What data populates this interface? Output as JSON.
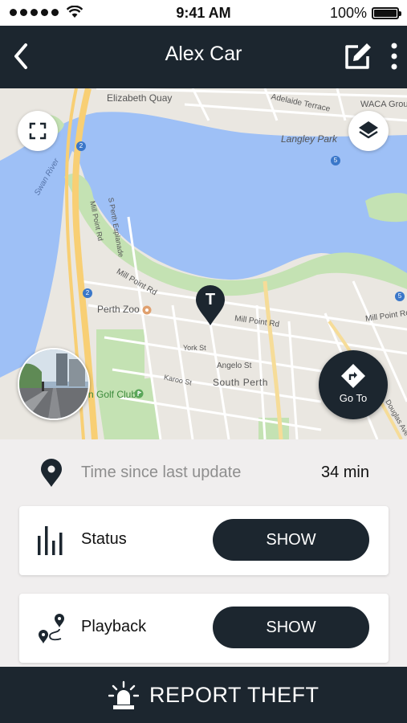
{
  "status_bar": {
    "time": "9:41 AM",
    "battery": "100%",
    "battery_level": 1.0
  },
  "nav": {
    "title": "Alex Car"
  },
  "map": {
    "labels": {
      "elizabeth_quay": "Elizabeth Quay",
      "adelaide_terrace": "Adelaide Terrace",
      "waca_ground": "WACA Ground",
      "langley_park": "Langley Park",
      "swan_river": "Swan River",
      "s_perth_espl": "S Perth Esplanade",
      "mill_point_rd": "Mill Point Rd",
      "mill_point_rd_2": "Mill Point Rd",
      "mill_point_rd_3": "Mill Point Rd",
      "mill_point_rd_4": "Mill Point Rd",
      "perth_zoo": "Perth Zoo",
      "york_st": "York St",
      "angelo_st": "Angelo St",
      "south_perth": "South Perth",
      "karoo_st": "Karoo St",
      "golf_club": "n Golf Club",
      "douglas_ave": "Douglas Ave"
    },
    "route_markers": [
      "2",
      "2",
      "5",
      "5"
    ],
    "pin_letter": "T",
    "goto_label": "Go To"
  },
  "info": {
    "label": "Time since last update",
    "value": "34 min"
  },
  "cards": [
    {
      "label": "Status",
      "button": "SHOW"
    },
    {
      "label": "Playback",
      "button": "SHOW"
    }
  ],
  "footer": {
    "label": "REPORT THEFT"
  },
  "colors": {
    "dark": "#1c262f",
    "water": "#9ec0f6",
    "park": "#c4e2b3",
    "road_major": "#f8cf74"
  }
}
